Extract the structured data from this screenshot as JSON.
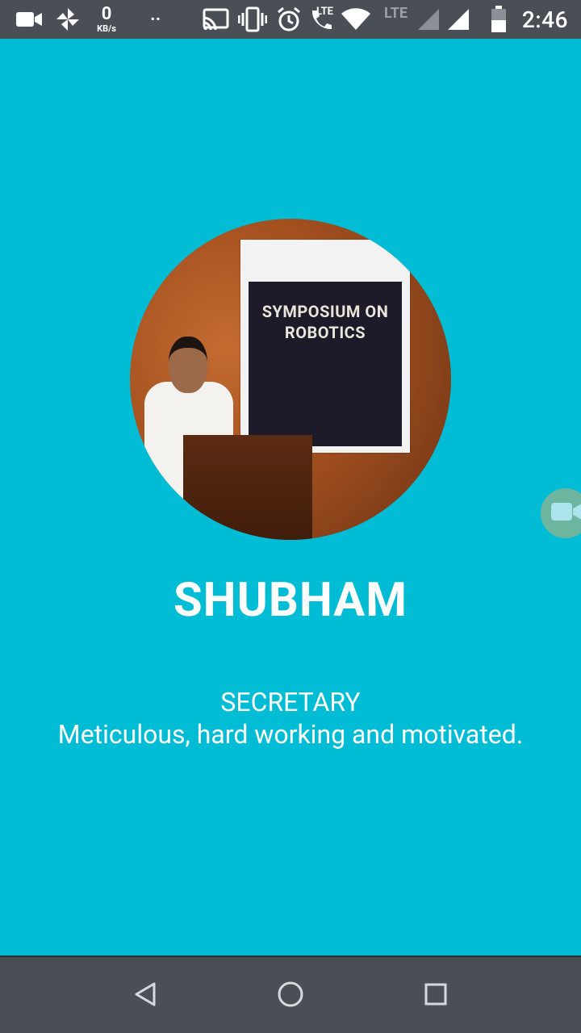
{
  "status_bar": {
    "net_speed_value": "0",
    "net_speed_unit": "KB/s",
    "dots": "··",
    "lte_label": "LTE",
    "lte2_label": "LTE",
    "time": "2:46",
    "icons": [
      "video-camera-icon",
      "pinwheel-icon",
      "cast-icon",
      "vibrate-icon",
      "alarm-icon",
      "wifi-call-icon",
      "wifi-icon",
      "signal-icon",
      "signal-icon",
      "battery-icon"
    ]
  },
  "profile": {
    "name": "SHUBHAM",
    "role": "SECRETARY",
    "description": "Meticulous, hard working and motivated.",
    "poster_text": "SYMPOSIUM ON ROBOTICS"
  },
  "floating_button": {
    "icon": "video-camera-icon"
  },
  "nav_bar": {
    "buttons": [
      "back-icon",
      "home-icon",
      "recents-icon"
    ]
  },
  "colors": {
    "background": "#00BCD4",
    "bars": "#4a4f56",
    "text": "#ffffff"
  }
}
